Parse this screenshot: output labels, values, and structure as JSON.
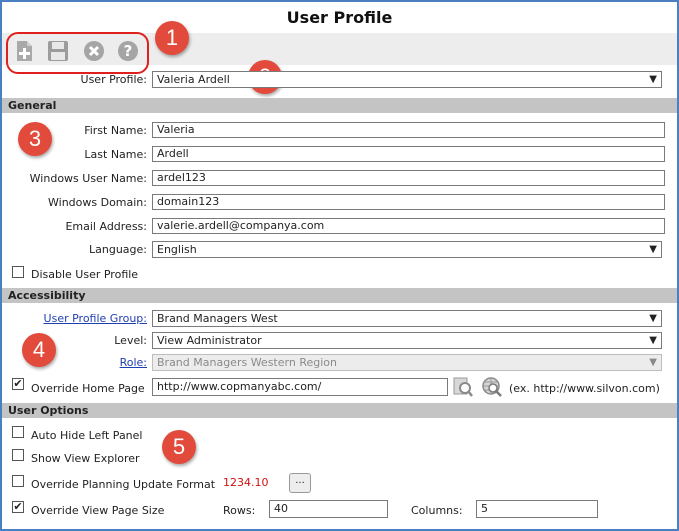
{
  "title": "User Profile",
  "toolbar": {
    "icons": [
      "new-document-icon",
      "save-icon",
      "cancel-icon",
      "help-icon"
    ]
  },
  "callouts": [
    "1",
    "2",
    "3",
    "4",
    "5"
  ],
  "user_profile": {
    "label": "User Profile:",
    "value": "Valeria Ardell"
  },
  "general": {
    "header": "General",
    "first_name_label": "First Name:",
    "first_name": "Valeria",
    "last_name_label": "Last Name:",
    "last_name": "Ardell",
    "windows_user_label": "Windows User Name:",
    "windows_user": "ardel123",
    "windows_domain_label": "Windows Domain:",
    "windows_domain": "domain123",
    "email_label": "Email Address:",
    "email": "valerie.ardell@companya.com",
    "language_label": "Language:",
    "language": "English",
    "disable_label": "Disable User Profile"
  },
  "accessibility": {
    "header": "Accessibility",
    "group_label": "User Profile Group:",
    "group": "Brand Managers West",
    "level_label": "Level:",
    "level": "View Administrator",
    "role_label": "Role:",
    "role": "Brand Managers Western Region",
    "home_label": "Override Home Page",
    "home_url": "http://www.copmanyabc.com/",
    "home_example": "(ex. http://www.silvon.com)"
  },
  "user_options": {
    "header": "User Options",
    "auto_hide_label": "Auto Hide Left Panel",
    "show_explorer_label": "Show View Explorer",
    "planning_label": "Override Planning Update Format",
    "planning_value": "1234.10",
    "ellipsis": "...",
    "page_size_label": "Override View Page Size",
    "rows_label": "Rows:",
    "rows": "40",
    "columns_label": "Columns:",
    "columns": "5"
  },
  "checked_glyph": "✔",
  "colors": {
    "callout": "#e24a3b",
    "section_bg": "#c4c4c4",
    "link": "#1f3fb0",
    "planning_value": "#d01010"
  }
}
